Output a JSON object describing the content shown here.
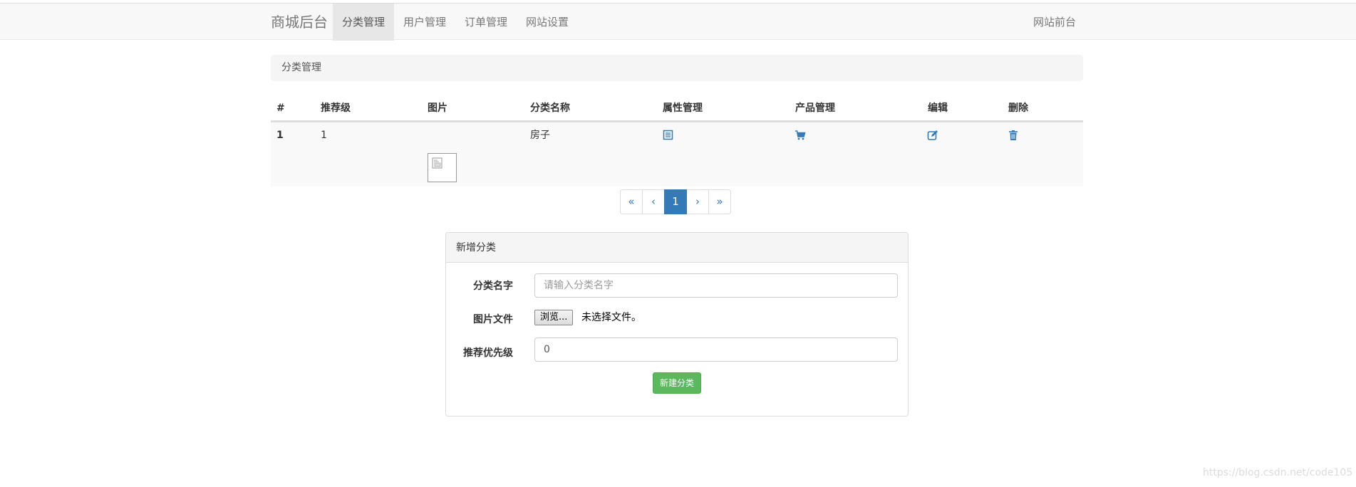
{
  "navbar": {
    "brand": "商城后台",
    "items": [
      {
        "label": "分类管理",
        "active": true
      },
      {
        "label": "用户管理",
        "active": false
      },
      {
        "label": "订单管理",
        "active": false
      },
      {
        "label": "网站设置",
        "active": false
      }
    ],
    "right_link": "网站前台"
  },
  "page_header": {
    "title": "分类管理"
  },
  "table": {
    "headers": [
      "#",
      "推荐级",
      "图片",
      "分类名称",
      "属性管理",
      "产品管理",
      "编辑",
      "删除"
    ],
    "rows": [
      {
        "id": "1",
        "priority": "1",
        "image_icon": "broken-image-icon",
        "name": "房子",
        "property_icon": "list-icon",
        "product_icon": "shopping-cart-icon",
        "edit_icon": "edit-icon",
        "delete_icon": "trash-icon"
      }
    ]
  },
  "pagination": {
    "first": "«",
    "prev": "‹",
    "pages": [
      "1"
    ],
    "current": "1",
    "next": "›",
    "last": "»"
  },
  "add_panel": {
    "title": "新增分类",
    "name_label": "分类名字",
    "name_placeholder": "请输入分类名字",
    "name_value": "",
    "image_label": "图片文件",
    "file_button": "浏览...",
    "file_status": "未选择文件。",
    "priority_label": "推荐优先级",
    "priority_value": "0",
    "submit_label": "新建分类"
  },
  "colors": {
    "primary": "#337ab7",
    "success": "#5cb85c",
    "navbar_bg": "#f8f8f8"
  },
  "watermark": "https://blog.csdn.net/code105"
}
